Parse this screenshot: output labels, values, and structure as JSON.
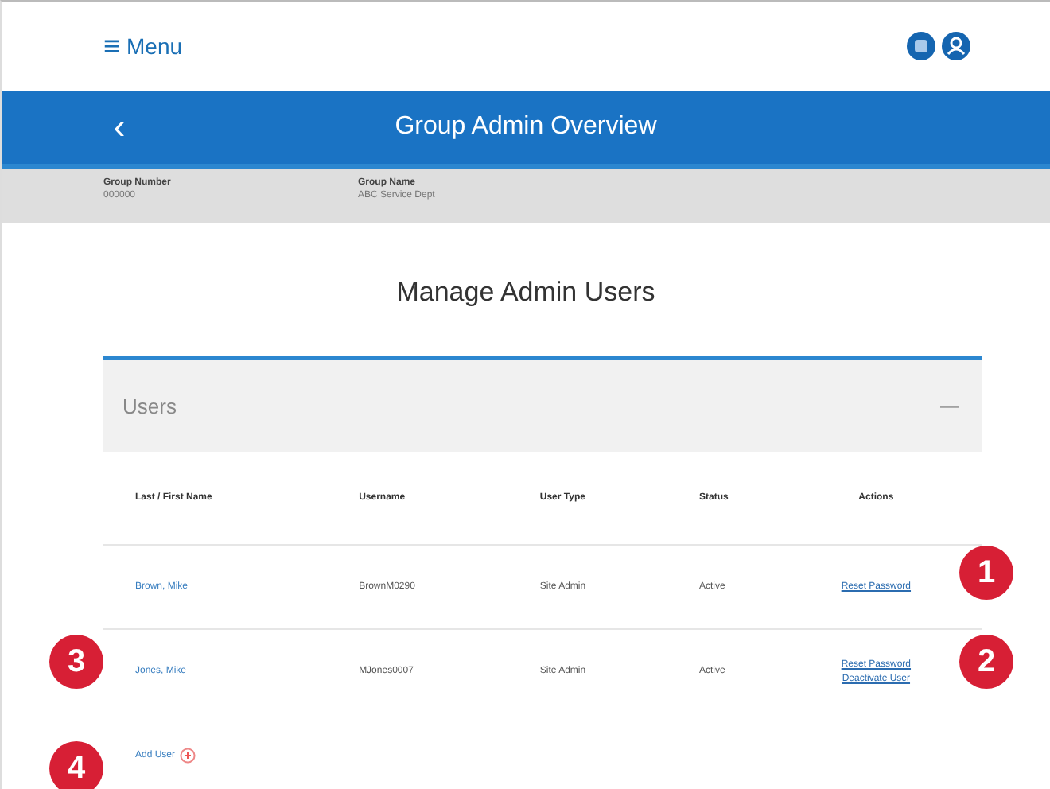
{
  "header": {
    "menu_icon": "≡",
    "menu_label": "Menu"
  },
  "title_bar": {
    "back": "‹",
    "title": "Group Admin Overview"
  },
  "group_info": [
    {
      "label": "Group Number",
      "value": "000000"
    },
    {
      "label": "Group Name",
      "value": "ABC Service Dept"
    }
  ],
  "heading": "Manage Admin Users",
  "users_panel": {
    "title": "Users",
    "expanded": true,
    "collapse": "—",
    "columns": [
      "Last / First Name",
      "Username",
      "User Type",
      "Status",
      "Actions"
    ],
    "rows": [
      {
        "name": "Brown, Mike",
        "username": "BrownM0290",
        "user_type": "Site Admin",
        "status": "Active",
        "actions": [
          "Reset Password"
        ]
      },
      {
        "name": "Jones, Mike",
        "username": "MJones0007",
        "user_type": "Site Admin",
        "status": "Active",
        "actions": [
          "Reset Password",
          "Deactivate User"
        ]
      }
    ],
    "add_user": "Add User"
  },
  "callouts": [
    "1",
    "3",
    "2",
    "4"
  ]
}
